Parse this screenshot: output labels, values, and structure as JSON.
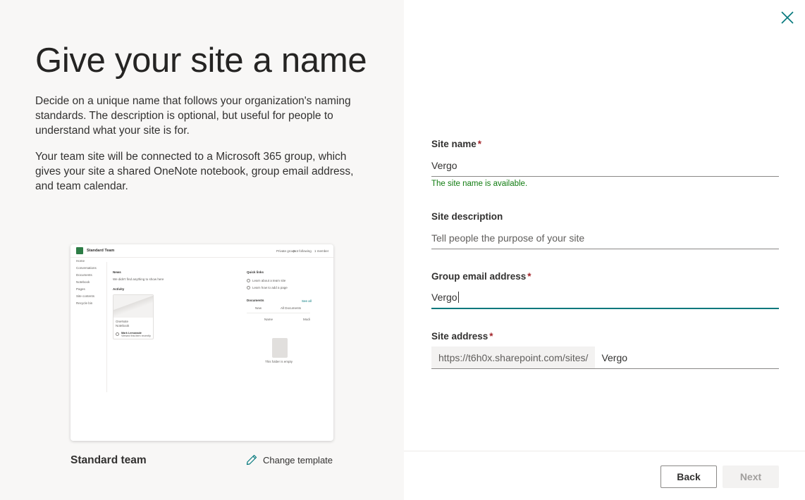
{
  "intro": {
    "title": "Give your site a name",
    "paragraph1": "Decide on a unique name that follows your organization's naming standards. The description is optional, but useful for people to understand what your site is for.",
    "paragraph2": "Your team site will be connected to a Microsoft 365 group, which gives your site a shared OneNote notebook, group email address, and team calendar."
  },
  "template": {
    "name": "Standard team",
    "change_label": "Change template",
    "preview": {
      "site_title": "Standard Team",
      "header_actions": [
        "Private group",
        "Not following",
        "1 member"
      ],
      "nav_items": [
        "Home",
        "Conversations",
        "Documents",
        "Notebook",
        "Pages",
        "Site contents",
        "Recycle bin"
      ],
      "news_heading": "News",
      "news_text": "We didn't find anything to show here",
      "activity_heading": "Activity",
      "activity_card_title": "OneNote",
      "activity_card_sub": "Notebook",
      "activity_user": "Mark Lemonade",
      "activity_user_sub": "Viewed this item recently",
      "quick_links_heading": "Quick links",
      "quick_links": [
        "Learn about a team site",
        "Learn how to add a page"
      ],
      "documents_heading": "Documents",
      "documents_see_all": "See all",
      "documents_toolbar": [
        "New",
        "All Documents"
      ],
      "documents_columns": [
        "Name",
        "Modi"
      ],
      "empty_text": "This folder is empty"
    }
  },
  "form": {
    "site_name": {
      "label": "Site name",
      "required_mark": "*",
      "value": "Vergo",
      "status": "The site name is available."
    },
    "site_description": {
      "label": "Site description",
      "placeholder": "Tell people the purpose of your site"
    },
    "group_email": {
      "label": "Group email address",
      "required_mark": "*",
      "value": "Vergo"
    },
    "site_address": {
      "label": "Site address",
      "required_mark": "*",
      "prefix": "https://t6h0x.sharepoint.com/sites/",
      "value": "Vergo"
    }
  },
  "footer": {
    "back_label": "Back",
    "next_label": "Next"
  },
  "colors": {
    "accent": "#03787c",
    "success": "#107c10",
    "required": "#a4262c",
    "left_pane_bg": "#f8f7f6"
  },
  "icons": {
    "close": "close-icon",
    "edit": "pencil-icon"
  }
}
